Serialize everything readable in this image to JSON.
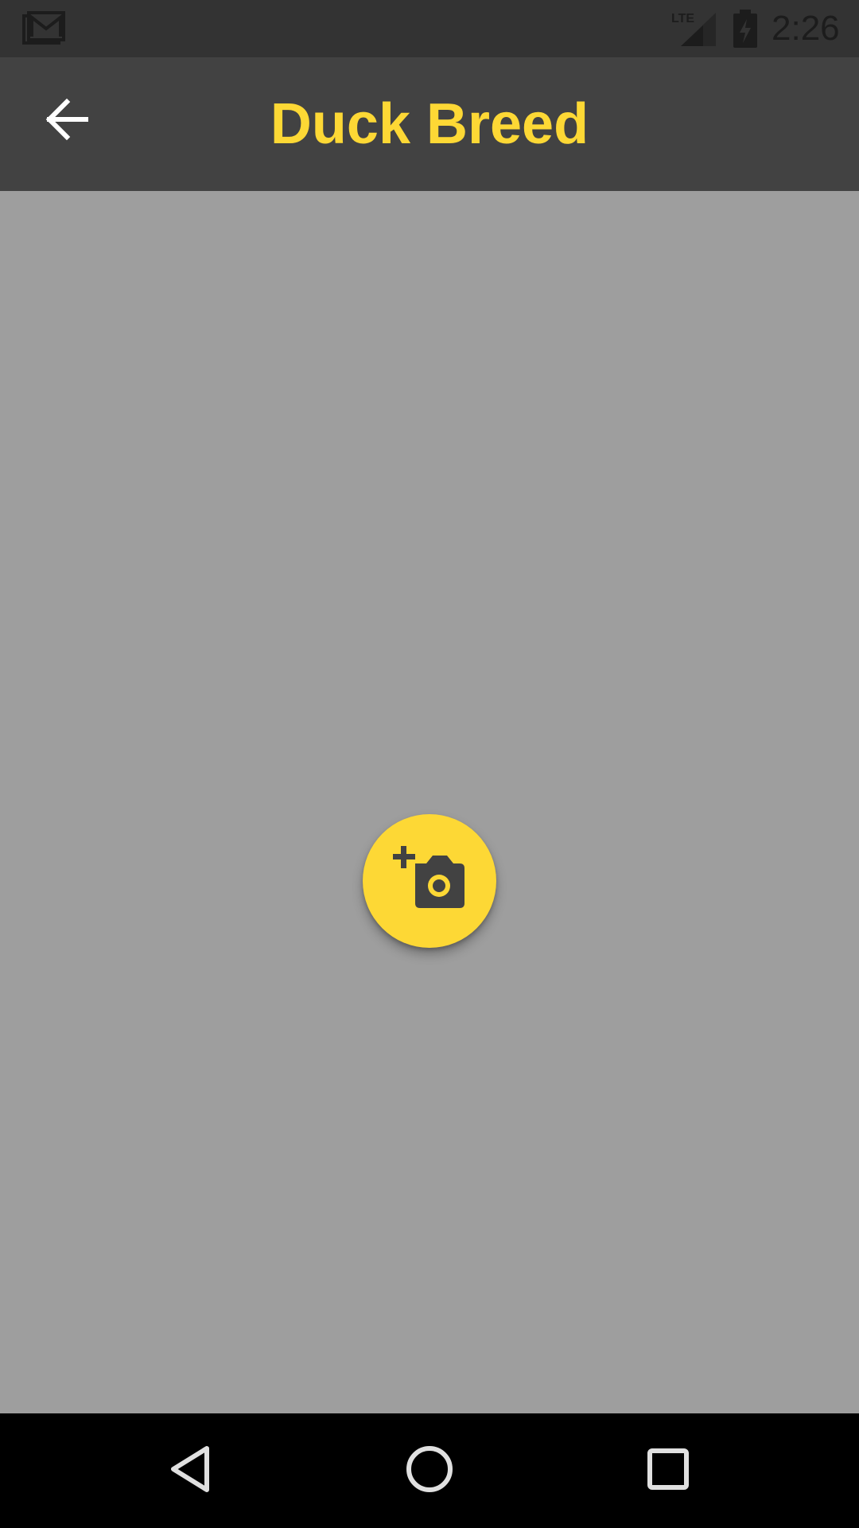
{
  "status_bar": {
    "time": "2:26",
    "network_label": "LTE",
    "icons": [
      "gmail-icon",
      "signal-icon",
      "battery-charging-icon"
    ]
  },
  "app_bar": {
    "title": "Duck Breed",
    "back_icon": "arrow-back-icon"
  },
  "content": {
    "fab_icon": "add-a-photo-icon"
  },
  "nav_bar": {
    "icons": [
      "nav-back-icon",
      "nav-home-icon",
      "nav-recents-icon"
    ]
  },
  "colors": {
    "status_bar": "#333333",
    "app_bar": "#424242",
    "accent": "#fdd835",
    "content_background": "#9e9e9e",
    "nav_bar": "#000000"
  }
}
